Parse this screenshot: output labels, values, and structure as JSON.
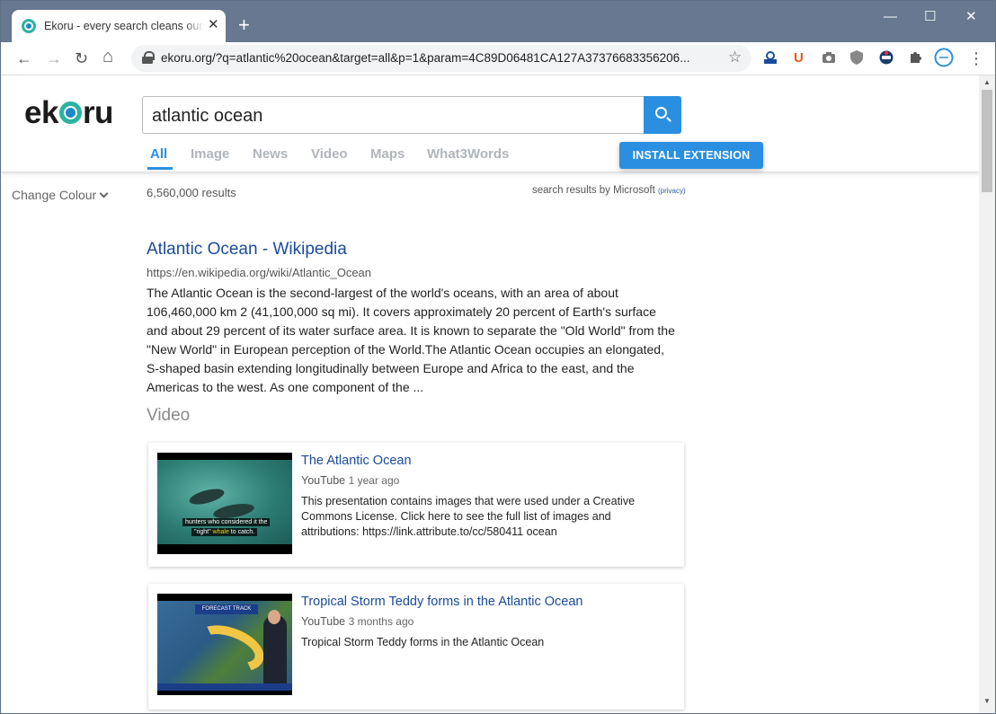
{
  "browser": {
    "tab_title": "Ekoru - every search cleans our oceans",
    "tab_close": "✕",
    "new_tab": "+",
    "url": "ekoru.org/?q=atlantic%20ocean&target=all&p=1&param=4C89D06481CA127A37376683356206...",
    "window_controls": {
      "minimize": "—",
      "maximize": "☐",
      "close": "✕"
    },
    "nav_icons": {
      "back": "←",
      "forward": "→",
      "reload": "↻",
      "home": "⌂",
      "star": "☆",
      "menu": "⋮"
    }
  },
  "site": {
    "logo_left": "ek",
    "logo_right": "ru",
    "search_query": "atlantic ocean",
    "tabs": [
      {
        "label": "All",
        "active": true
      },
      {
        "label": "Image"
      },
      {
        "label": "News"
      },
      {
        "label": "Video"
      },
      {
        "label": "Maps"
      },
      {
        "label": "What3Words"
      }
    ],
    "install_button": "INSTALL EXTENSION",
    "change_colour": "Change Colour",
    "result_count": "6,560,000 results",
    "provider": "search results by Microsoft",
    "privacy": "(privacy)"
  },
  "result": {
    "title": "Atlantic Ocean - Wikipedia",
    "url": "https://en.wikipedia.org/wiki/Atlantic_Ocean",
    "snippet": "The Atlantic Ocean is the second-largest of the world's oceans, with an area of about 106,460,000 km 2 (41,100,000 sq mi). It covers approximately 20 percent of Earth's surface and about 29 percent of its water surface area. It is known to separate the \"Old World\" from the \"New World\" in European perception of the World.The Atlantic Ocean occupies an elongated, S-shaped basin extending longitudinally between Europe and Africa to the east, and the Americas to the west. As one component of the ..."
  },
  "video_section": {
    "title": "Video",
    "items": [
      {
        "title": "The Atlantic Ocean",
        "source": "YouTube",
        "ago": "1 year ago",
        "description": "This presentation contains images that were used under a Creative Commons License. Click here to see the full list of images and attributions: https://link.attribute.to/cc/580411 ocean",
        "caption_line1": "hunters who considered it the",
        "caption_line2_a": "\"right\" ",
        "caption_line2_b": "whale",
        "caption_line2_c": " to catch."
      },
      {
        "title": "Tropical Storm Teddy forms in the Atlantic Ocean",
        "source": "YouTube",
        "ago": "3 months ago",
        "description": "Tropical Storm Teddy forms in the Atlantic Ocean",
        "thumb_label": "FORECAST TRACK"
      }
    ]
  },
  "colors": {
    "accent": "#2a8fe0",
    "link": "#1a4b9b",
    "titlebar": "#677890",
    "logo_teal": "#2bb3a0",
    "logo_blue": "#1e88c7"
  }
}
